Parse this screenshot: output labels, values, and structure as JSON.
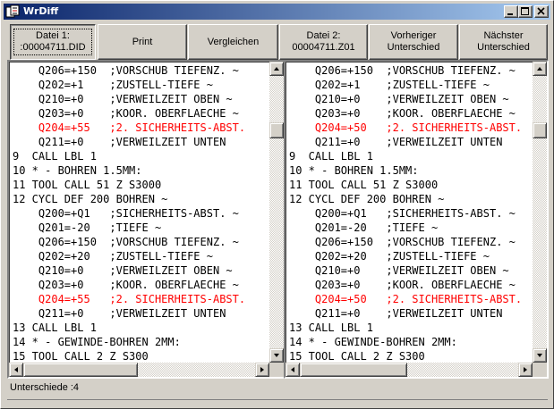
{
  "window": {
    "title": "WrDiff"
  },
  "toolbar": {
    "datei1": [
      "Datei 1:",
      ":00004711.DID"
    ],
    "print": "Print",
    "vergleichen": "Vergleichen",
    "datei2": [
      "Datei 2:",
      "00004711.Z01"
    ],
    "vorheriger": [
      "Vorheriger",
      "Unterschied"
    ],
    "naechster": [
      "Nächster",
      "Unterschied"
    ]
  },
  "left_pane": {
    "lines": [
      {
        "text": "    Q206=+150  ;VORSCHUB TIEFENZ. ~",
        "diff": false
      },
      {
        "text": "    Q202=+1    ;ZUSTELL-TIEFE ~",
        "diff": false
      },
      {
        "text": "    Q210=+0    ;VERWEILZEIT OBEN ~",
        "diff": false
      },
      {
        "text": "    Q203=+0    ;KOOR. OBERFLAECHE ~",
        "diff": false
      },
      {
        "text": "    Q204=+55   ;2. SICHERHEITS-ABST.",
        "diff": true
      },
      {
        "text": "    Q211=+0    ;VERWEILZEIT UNTEN",
        "diff": false
      },
      {
        "text": "9  CALL LBL 1",
        "diff": false
      },
      {
        "text": "10 * - BOHREN 1.5MM:",
        "diff": false
      },
      {
        "text": "11 TOOL CALL 51 Z S3000",
        "diff": false
      },
      {
        "text": "12 CYCL DEF 200 BOHREN ~",
        "diff": false
      },
      {
        "text": "    Q200=+Q1   ;SICHERHEITS-ABST. ~",
        "diff": false
      },
      {
        "text": "    Q201=-20   ;TIEFE ~",
        "diff": false
      },
      {
        "text": "    Q206=+150  ;VORSCHUB TIEFENZ. ~",
        "diff": false
      },
      {
        "text": "    Q202=+20   ;ZUSTELL-TIEFE ~",
        "diff": false
      },
      {
        "text": "    Q210=+0    ;VERWEILZEIT OBEN ~",
        "diff": false
      },
      {
        "text": "    Q203=+0    ;KOOR. OBERFLAECHE ~",
        "diff": false
      },
      {
        "text": "    Q204=+55   ;2. SICHERHEITS-ABST.",
        "diff": true
      },
      {
        "text": "    Q211=+0    ;VERWEILZEIT UNTEN",
        "diff": false
      },
      {
        "text": "13 CALL LBL 1",
        "diff": false
      },
      {
        "text": "14 * - GEWINDE-BOHREN 2MM:",
        "diff": false
      },
      {
        "text": "15 TOOL CALL 2 Z S300",
        "diff": false
      }
    ]
  },
  "right_pane": {
    "lines": [
      {
        "text": "    Q206=+150  ;VORSCHUB TIEFENZ. ~",
        "diff": false
      },
      {
        "text": "    Q202=+1    ;ZUSTELL-TIEFE ~",
        "diff": false
      },
      {
        "text": "    Q210=+0    ;VERWEILZEIT OBEN ~",
        "diff": false
      },
      {
        "text": "    Q203=+0    ;KOOR. OBERFLAECHE ~",
        "diff": false
      },
      {
        "text": "    Q204=+50   ;2. SICHERHEITS-ABST.",
        "diff": true
      },
      {
        "text": "    Q211=+0    ;VERWEILZEIT UNTEN",
        "diff": false
      },
      {
        "text": "9  CALL LBL 1",
        "diff": false
      },
      {
        "text": "10 * - BOHREN 1.5MM:",
        "diff": false
      },
      {
        "text": "11 TOOL CALL 51 Z S3000",
        "diff": false
      },
      {
        "text": "12 CYCL DEF 200 BOHREN ~",
        "diff": false
      },
      {
        "text": "    Q200=+Q1   ;SICHERHEITS-ABST. ~",
        "diff": false
      },
      {
        "text": "    Q201=-20   ;TIEFE ~",
        "diff": false
      },
      {
        "text": "    Q206=+150  ;VORSCHUB TIEFENZ. ~",
        "diff": false
      },
      {
        "text": "    Q202=+20   ;ZUSTELL-TIEFE ~",
        "diff": false
      },
      {
        "text": "    Q210=+0    ;VERWEILZEIT OBEN ~",
        "diff": false
      },
      {
        "text": "    Q203=+0    ;KOOR. OBERFLAECHE ~",
        "diff": false
      },
      {
        "text": "    Q204=+50   ;2. SICHERHEITS-ABST.",
        "diff": true
      },
      {
        "text": "    Q211=+0    ;VERWEILZEIT UNTEN",
        "diff": false
      },
      {
        "text": "13 CALL LBL 1",
        "diff": false
      },
      {
        "text": "14 * - GEWINDE-BOHREN 2MM:",
        "diff": false
      },
      {
        "text": "15 TOOL CALL 2 Z S300",
        "diff": false
      }
    ]
  },
  "status": {
    "text": "Unterschiede :4"
  },
  "colors": {
    "diff": "#ff0000",
    "titlebar_start": "#0a246a",
    "titlebar_end": "#a6caf0"
  },
  "icons": [
    "app-icon",
    "minimize-icon",
    "maximize-icon",
    "close-icon",
    "scroll-up-icon",
    "scroll-down-icon",
    "scroll-left-icon",
    "scroll-right-icon"
  ]
}
